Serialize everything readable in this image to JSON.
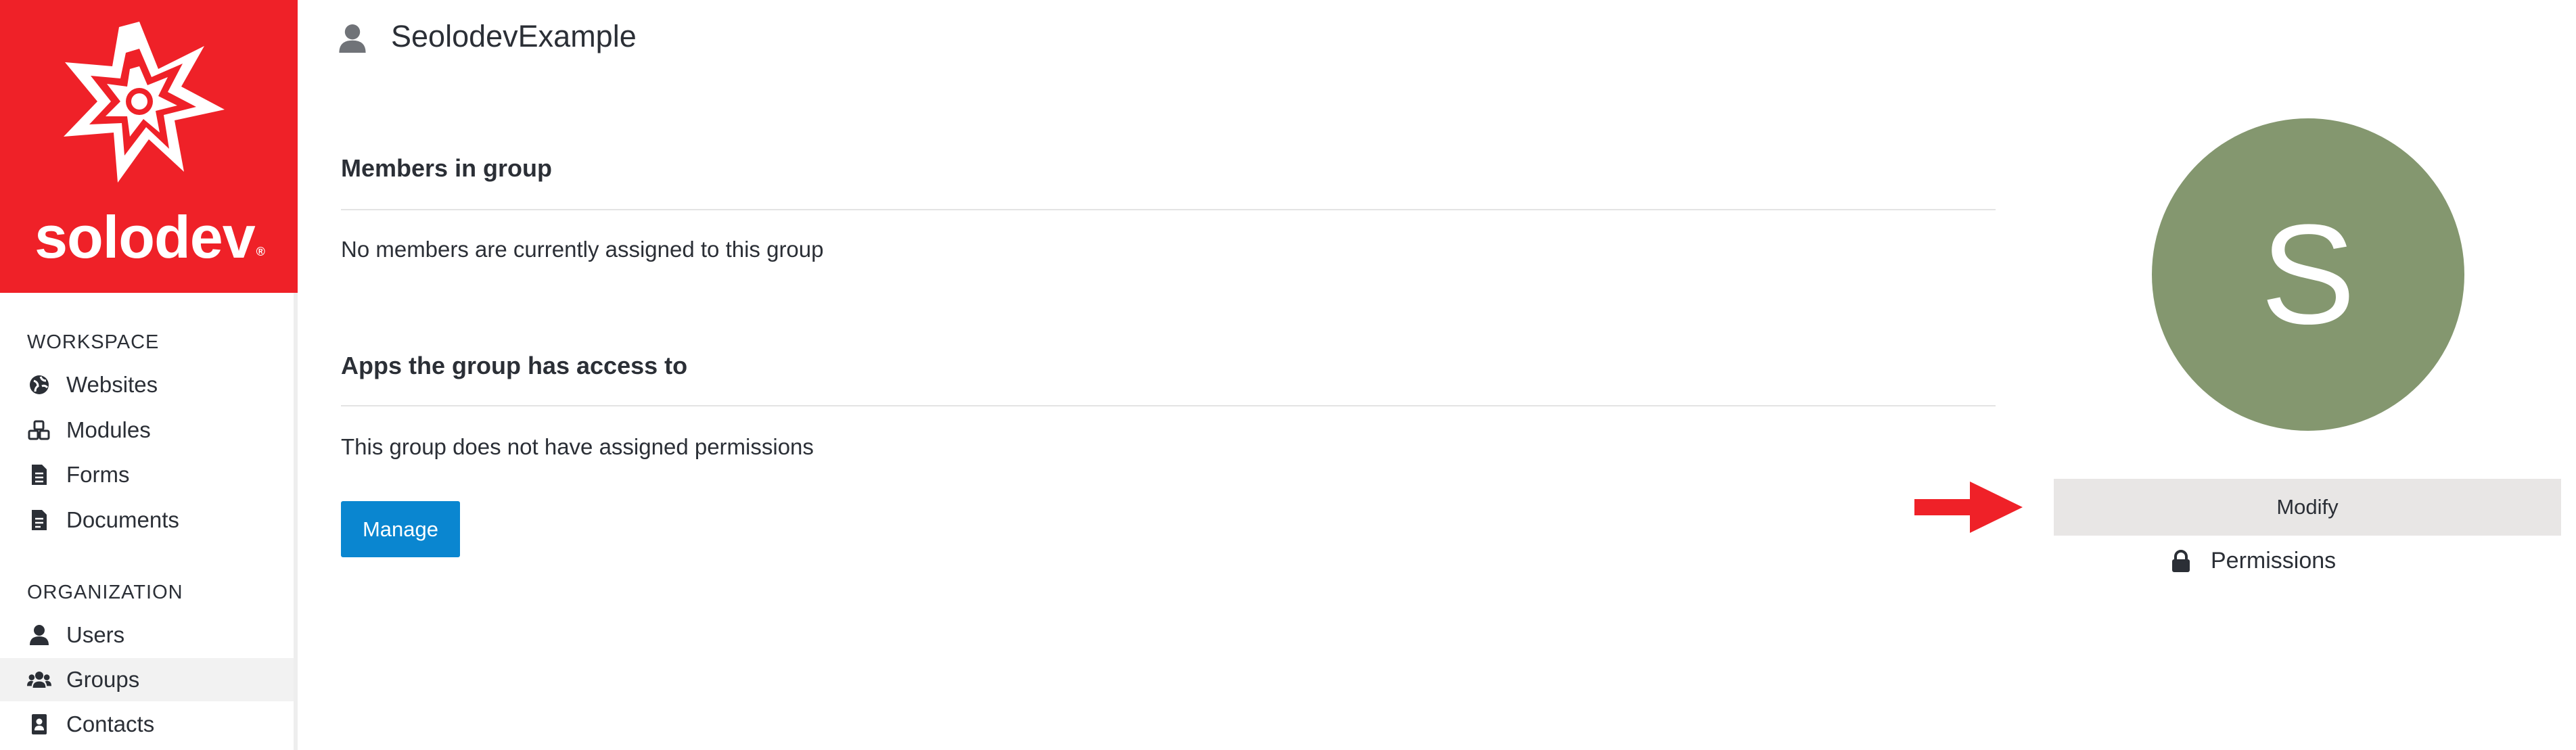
{
  "brand": {
    "name": "solodev",
    "trademark": "®",
    "color": "#ef2128"
  },
  "sidebar": {
    "workspace_heading": "WORKSPACE",
    "workspace_items": [
      {
        "label": "Websites",
        "icon": "globe-icon"
      },
      {
        "label": "Modules",
        "icon": "cubes-icon"
      },
      {
        "label": "Forms",
        "icon": "form-document-icon"
      },
      {
        "label": "Documents",
        "icon": "document-icon"
      }
    ],
    "organization_heading": "ORGANIZATION",
    "organization_items": [
      {
        "label": "Users",
        "icon": "user-icon"
      },
      {
        "label": "Groups",
        "icon": "users-icon",
        "active": true
      },
      {
        "label": "Contacts",
        "icon": "address-book-icon"
      }
    ]
  },
  "header": {
    "title": "SeolodevExample",
    "icon": "user-icon"
  },
  "members": {
    "title": "Members in group",
    "empty_text": "No members are currently assigned to this group"
  },
  "apps": {
    "title": "Apps the group has access to",
    "empty_text": "This group does not have assigned permissions",
    "manage_label": "Manage"
  },
  "profile": {
    "avatar_letter": "S",
    "avatar_color": "#84976f",
    "modify_label": "Modify",
    "permissions_label": "Permissions"
  },
  "colors": {
    "accent": "#0a86d0",
    "arrow": "#ef2128"
  }
}
